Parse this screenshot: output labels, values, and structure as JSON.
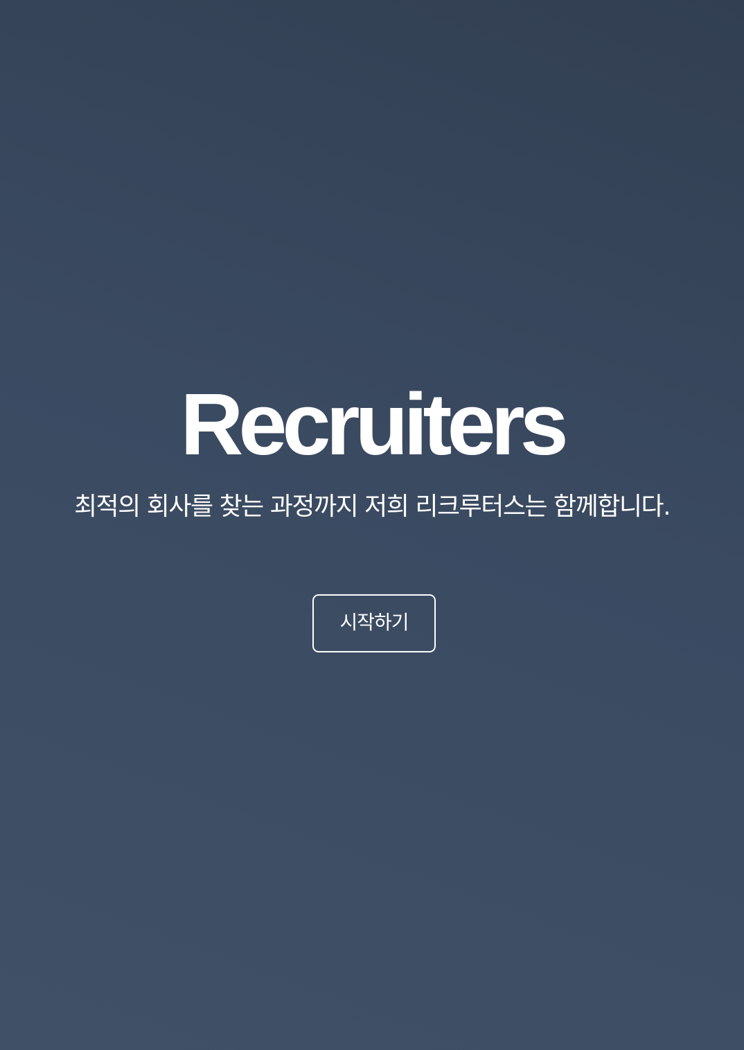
{
  "hero": {
    "title": "Recruiters",
    "tagline": "최적의 회사를 찾는 과정까지 저희 리크루터스는 함께합니다.",
    "start_button_label": "시작하기"
  },
  "colors": {
    "background_top": "#323f52",
    "background_bottom": "#405066",
    "text": "#ffffff"
  }
}
